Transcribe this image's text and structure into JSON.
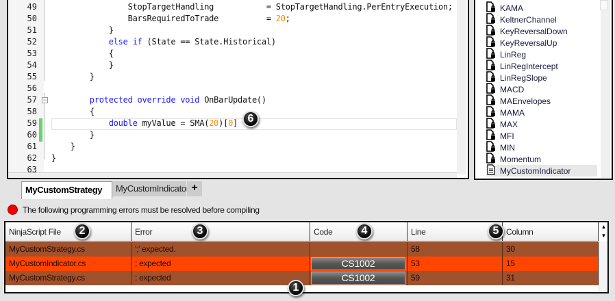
{
  "editor": {
    "lines": [
      {
        "n": "49",
        "html": "                StopTargetHandling           = StopTargetHandling.PerEntryExecution;"
      },
      {
        "n": "50",
        "html": "                BarsRequiredToTrade          = <span class='num'>20</span>;"
      },
      {
        "n": "51",
        "html": "            }"
      },
      {
        "n": "52",
        "html": "            <span class='kw'>else if</span> (State == State.Historical)"
      },
      {
        "n": "53",
        "html": "            {"
      },
      {
        "n": "54",
        "html": "            }"
      },
      {
        "n": "55",
        "html": "        }"
      },
      {
        "n": "56",
        "html": ""
      },
      {
        "n": "57",
        "html": "        <span class='kw'>protected override void</span> OnBarUpdate()"
      },
      {
        "n": "58",
        "html": "        {"
      },
      {
        "n": "59",
        "html": "            <span class='kw'>double</span> myValue = SMA(<span class='num'>20</span>)[<span class='num'>0</span>]"
      },
      {
        "n": "60",
        "html": "        }"
      },
      {
        "n": "61",
        "html": "    }"
      },
      {
        "n": "62",
        "html": "}"
      },
      {
        "n": "63",
        "html": ""
      }
    ]
  },
  "tree": {
    "items": [
      "KAMA",
      "KeltnerChannel",
      "KeyReversalDown",
      "KeyReversalUp",
      "LinReg",
      "LinRegIntercept",
      "LinRegSlope",
      "MACD",
      "MAEnvelopes",
      "MAMA",
      "MAX",
      "MFI",
      "MIN",
      "Momentum",
      "MyCustomIndicator"
    ],
    "selected": "MyCustomIndicator"
  },
  "tabs": {
    "active": "MyCustomStrategy",
    "other": "MyCustomIndicator",
    "add": "+"
  },
  "status": {
    "message": "The following programming errors must be resolved before compiling",
    "color": "#ee0000"
  },
  "errors": {
    "headers": [
      "NinjaScript File",
      "Error",
      "Code",
      "Line",
      "Column"
    ],
    "rows": [
      {
        "file": "MyCustomStrategy.cs",
        "error": "';' expected.",
        "code": "",
        "line": "58",
        "column": "30",
        "color": "#a0522d"
      },
      {
        "file": "MyCustomIndicator.cs",
        "error": "; expected",
        "code": "CS1002",
        "line": "53",
        "column": "15",
        "color": "#ff4500"
      },
      {
        "file": "MyCustomStrategy.cs",
        "error": "; expected",
        "code": "CS1002",
        "line": "59",
        "column": "31",
        "color": "#a0522d"
      }
    ]
  },
  "callouts": [
    "1",
    "2",
    "3",
    "4",
    "5",
    "6"
  ]
}
